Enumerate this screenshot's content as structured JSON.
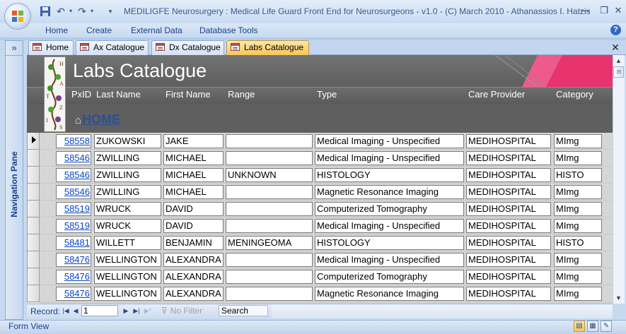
{
  "app": {
    "title": "MEDILIGFE Neurosurgery : Medical Life Guard Front End for Neurosurgeons - v1.0 - (C) March 2010 - Athanassios I. Hatzis"
  },
  "ribbon": {
    "tabs": [
      "Home",
      "Create",
      "External Data",
      "Database Tools"
    ]
  },
  "nav": {
    "chevron": "»",
    "label": "Navigation Pane"
  },
  "doc_tabs": [
    {
      "label": "Home",
      "active": false
    },
    {
      "label": "Ax Catalogue",
      "active": false
    },
    {
      "label": "Dx Catalogue",
      "active": false
    },
    {
      "label": "Labs Catalogue",
      "active": true
    }
  ],
  "form": {
    "title": "Labs Catalogue",
    "home_link": "HOME",
    "logo_letters": [
      "H",
      "A",
      "T",
      "Z",
      "I",
      "S"
    ],
    "columns": [
      "PxID",
      "Last Name",
      "First Name",
      "Range",
      "Type",
      "Care Provider",
      "Category"
    ]
  },
  "records": [
    {
      "pxid": "58558",
      "last": "ZUKOWSKI",
      "first": "JAKE",
      "range": "",
      "type": "Medical Imaging - Unspecified",
      "care": "MEDIHOSPITAL",
      "cat": "MImg",
      "current": true
    },
    {
      "pxid": "58546",
      "last": "ZWILLING",
      "first": "MICHAEL",
      "range": "",
      "type": "Medical Imaging - Unspecified",
      "care": "MEDIHOSPITAL",
      "cat": "MImg",
      "current": false
    },
    {
      "pxid": "58546",
      "last": "ZWILLING",
      "first": "MICHAEL",
      "range": "UNKNOWN",
      "type": "HISTOLOGY",
      "care": "MEDIHOSPITAL",
      "cat": "HISTO",
      "current": false
    },
    {
      "pxid": "58546",
      "last": "ZWILLING",
      "first": "MICHAEL",
      "range": "",
      "type": "Magnetic Resonance Imaging",
      "care": "MEDIHOSPITAL",
      "cat": "MImg",
      "current": false
    },
    {
      "pxid": "58519",
      "last": "WRUCK",
      "first": "DAVID",
      "range": "",
      "type": "Computerized Tomography",
      "care": "MEDIHOSPITAL",
      "cat": "MImg",
      "current": false
    },
    {
      "pxid": "58519",
      "last": "WRUCK",
      "first": "DAVID",
      "range": "",
      "type": "Medical Imaging - Unspecified",
      "care": "MEDIHOSPITAL",
      "cat": "MImg",
      "current": false
    },
    {
      "pxid": "58481",
      "last": "WILLETT",
      "first": "BENJAMIN",
      "range": "MENINGEOMA",
      "type": "HISTOLOGY",
      "care": "MEDIHOSPITAL",
      "cat": "HISTO",
      "current": false
    },
    {
      "pxid": "58476",
      "last": "WELLINGTON",
      "first": "ALEXANDRA",
      "range": "",
      "type": "Medical Imaging - Unspecified",
      "care": "MEDIHOSPITAL",
      "cat": "MImg",
      "current": false
    },
    {
      "pxid": "58476",
      "last": "WELLINGTON",
      "first": "ALEXANDRA",
      "range": "",
      "type": "Computerized Tomography",
      "care": "MEDIHOSPITAL",
      "cat": "MImg",
      "current": false
    },
    {
      "pxid": "58476",
      "last": "WELLINGTON",
      "first": "ALEXANDRA",
      "range": "",
      "type": "Magnetic Resonance Imaging",
      "care": "MEDIHOSPITAL",
      "cat": "MImg",
      "current": false
    }
  ],
  "record_nav": {
    "label": "Record:",
    "current": "1",
    "filter_label": "No Filter",
    "search_value": "Search"
  },
  "status": {
    "text": "Form View"
  },
  "colors": {
    "header_bg": "#5f5f5f",
    "accent_pink": "#e8336f",
    "active_tab": "#f9c55b",
    "link": "#0645c8",
    "nav_text": "#15428b"
  }
}
